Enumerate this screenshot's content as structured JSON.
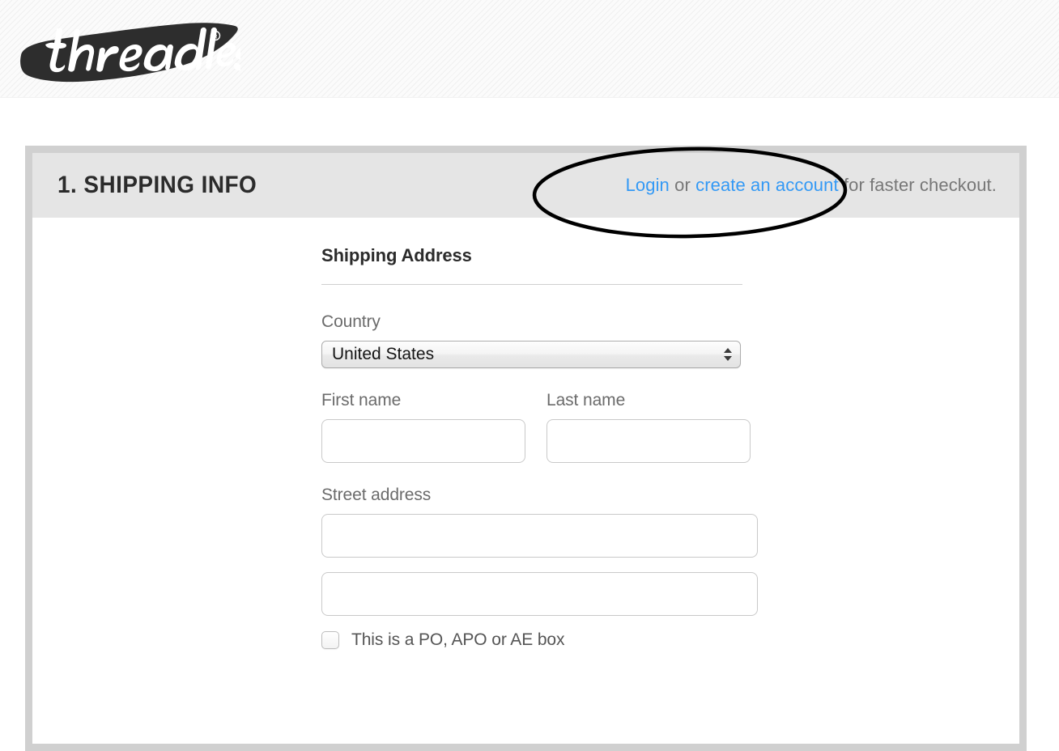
{
  "brand": {
    "logo_icon": "threadless-wordmark-logo",
    "logo_text": "threadless",
    "registered_mark": "®"
  },
  "panel": {
    "step_title": "1. SHIPPING INFO",
    "login_prefix": "",
    "login_link": "Login",
    "or_text": " or ",
    "create_account_link": "create an account",
    "suffix_text": " for faster checkout."
  },
  "form": {
    "section_heading": "Shipping Address",
    "country": {
      "label": "Country",
      "selected": "United States",
      "stepper_icon": "up-down-stepper-icon"
    },
    "first_name": {
      "label": "First name",
      "value": "",
      "placeholder": ""
    },
    "last_name": {
      "label": "Last name",
      "value": "",
      "placeholder": ""
    },
    "street": {
      "label": "Street address",
      "line1_value": "",
      "line1_placeholder": "",
      "line2_value": "",
      "line2_placeholder": ""
    },
    "po_box": {
      "label": "This is a PO, APO or AE box",
      "checked": false
    }
  },
  "annotation": {
    "shape": "ellipse-highlight",
    "stroke_color": "#000000"
  },
  "colors": {
    "link_blue": "#3399f5",
    "panel_frame": "#d0d0d0",
    "panel_header_bg": "#e5e5e5",
    "body_bg": "#ffffff",
    "label_gray": "#6b6b6b",
    "heading_dark": "#2b2b2b",
    "logo_dark": "#2d2d2d"
  }
}
